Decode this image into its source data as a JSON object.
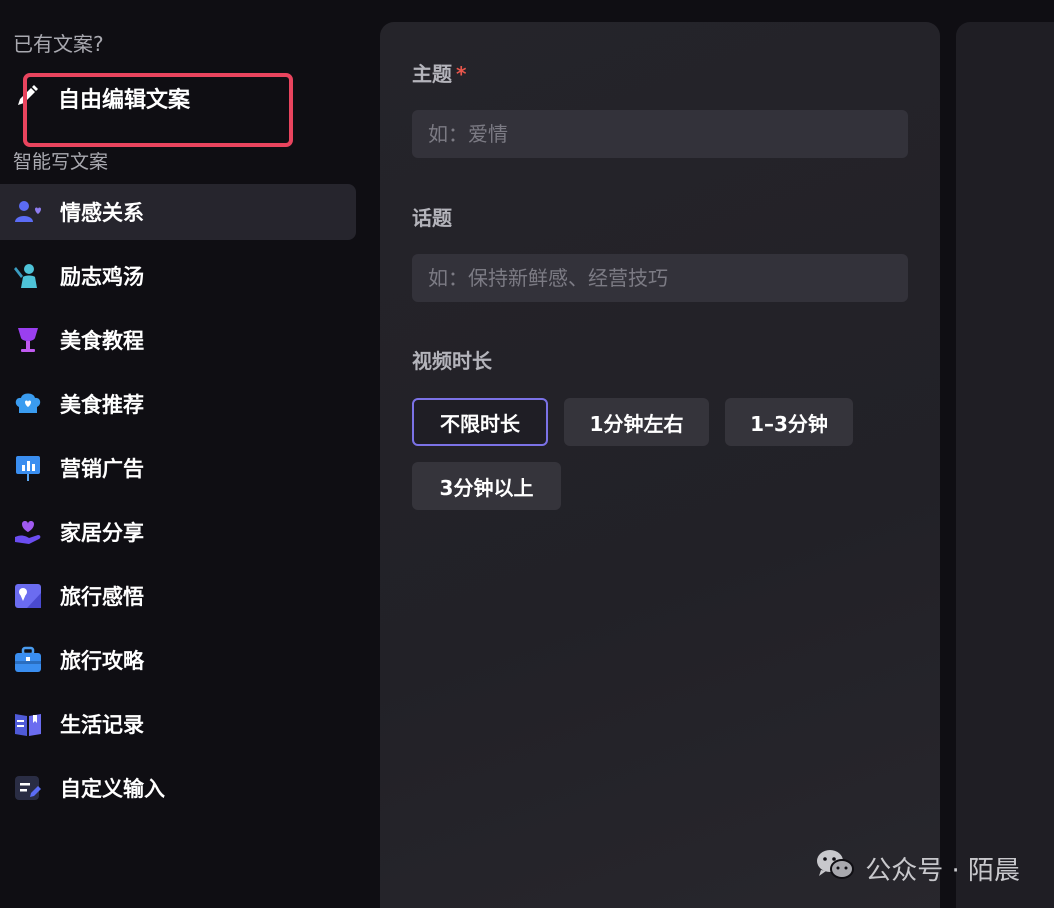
{
  "sidebar": {
    "has_copy_heading": "已有文案?",
    "free_edit_label": "自由编辑文案",
    "smart_heading": "智能写文案",
    "items": [
      {
        "label": "情感关系",
        "icon": "couple-icon"
      },
      {
        "label": "励志鸡汤",
        "icon": "cheering-person-icon"
      },
      {
        "label": "美食教程",
        "icon": "wine-glass-icon"
      },
      {
        "label": "美食推荐",
        "icon": "chef-hat-icon"
      },
      {
        "label": "营销广告",
        "icon": "presentation-board-icon"
      },
      {
        "label": "家居分享",
        "icon": "heart-hand-icon"
      },
      {
        "label": "旅行感悟",
        "icon": "map-pin-icon"
      },
      {
        "label": "旅行攻略",
        "icon": "suitcase-icon"
      },
      {
        "label": "生活记录",
        "icon": "open-book-icon"
      },
      {
        "label": "自定义输入",
        "icon": "edit-note-icon"
      }
    ]
  },
  "form": {
    "topic_label": "主题",
    "topic_required": "*",
    "topic_placeholder": "如：爱情",
    "subject_label": "话题",
    "subject_placeholder": "如：保持新鲜感、经营技巧",
    "duration_label": "视频时长",
    "duration_options": [
      "不限时长",
      "1分钟左右",
      "1–3分钟",
      "3分钟以上"
    ],
    "selected_duration": "不限时长"
  },
  "watermark": {
    "text": "公众号 · 陌晨"
  },
  "colors": {
    "accent": "#7b72e6",
    "highlight": "#e9445e",
    "required": "#e9574c"
  }
}
